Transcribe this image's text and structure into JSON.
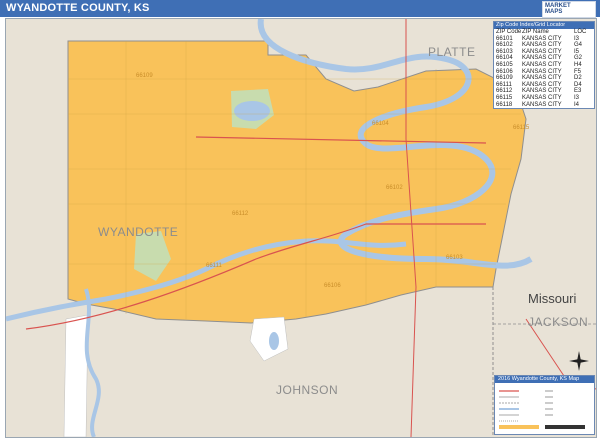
{
  "header": {
    "title": "WYANDOTTE COUNTY, KS",
    "brand_color": "#3f6fb5"
  },
  "labels": {
    "platte": "PLATTE",
    "wyandotte": "WYANDOTTE",
    "missouri": "Missouri",
    "jackson": "JACKSON",
    "johnson": "JOHNSON"
  },
  "zip_index": {
    "title": "Zip Code Index/Grid Locator",
    "headers": [
      "ZIP Code",
      "ZIP Name",
      "LOC"
    ],
    "rows": [
      [
        "66101",
        "KANSAS CITY",
        "I3"
      ],
      [
        "66102",
        "KANSAS CITY",
        "G4"
      ],
      [
        "66103",
        "KANSAS CITY",
        "I5"
      ],
      [
        "66104",
        "KANSAS CITY",
        "G2"
      ],
      [
        "66105",
        "KANSAS CITY",
        "H4"
      ],
      [
        "66106",
        "KANSAS CITY",
        "F5"
      ],
      [
        "66109",
        "KANSAS CITY",
        "D2"
      ],
      [
        "66111",
        "KANSAS CITY",
        "D4"
      ],
      [
        "66112",
        "KANSAS CITY",
        "E3"
      ],
      [
        "66115",
        "KANSAS CITY",
        "I3"
      ],
      [
        "66118",
        "KANSAS CITY",
        "I4"
      ]
    ]
  },
  "legend": {
    "title": "2016 Wyandotte County, KS Map"
  },
  "zip_labels": [
    "66109",
    "66104",
    "66115",
    "66112",
    "66111",
    "66106",
    "66102",
    "66103"
  ],
  "colors": {
    "county_fill": "#f9c25a",
    "outside_fill": "#e8e2d6",
    "water": "#a9c6e6",
    "highway": "#d9534f",
    "border": "#8f8f8f",
    "park": "#c8dcae"
  }
}
